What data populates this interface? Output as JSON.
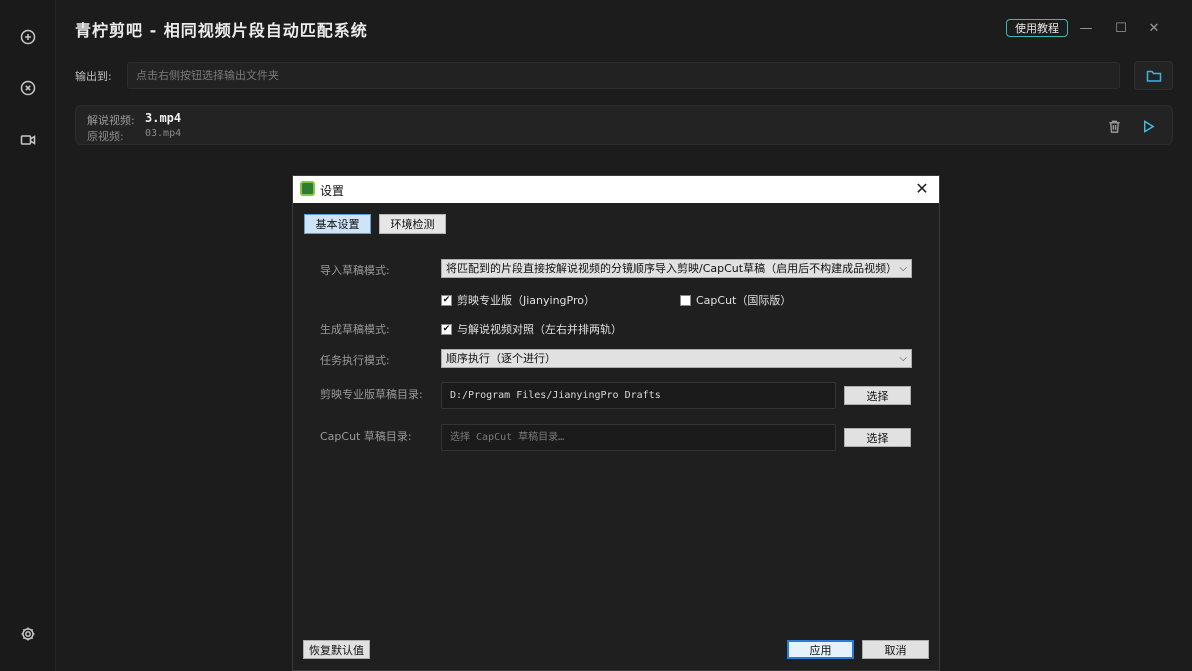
{
  "app": {
    "title": "青柠剪吧 - 相同视频片段自动匹配系统",
    "tutorial_label": "使用教程",
    "minimize": "—",
    "maximize": "☐",
    "close": "✕"
  },
  "output": {
    "label": "输出到:",
    "placeholder": "点击右侧按钮选择输出文件夹"
  },
  "task": {
    "narration_label": "解说视频:",
    "narration_value": "3.mp4",
    "source_label": "原视频:",
    "source_value": "03.mp4"
  },
  "dialog": {
    "title": "设置",
    "close": "✕",
    "tabs": [
      {
        "label": "基本设置",
        "active": true
      },
      {
        "label": "环境检测",
        "active": false
      }
    ],
    "import_mode": {
      "label": "导入草稿模式:",
      "value": "将匹配到的片段直接按解说视频的分镜顺序导入剪映/CapCut草稿（启用后不构建成品视频）"
    },
    "jianying_pro": {
      "label": "剪映专业版（JianyingPro）",
      "checked": true
    },
    "capcut": {
      "label": "CapCut（国际版）",
      "checked": false
    },
    "gen_mode": {
      "label": "生成草稿模式:",
      "option_label": "与解说视频对照（左右并排两轨）",
      "checked": true
    },
    "exec_mode": {
      "label": "任务执行模式:",
      "value": "顺序执行（逐个进行）"
    },
    "jianying_dir": {
      "label": "剪映专业版草稿目录:",
      "value": "D:/Program Files/JianyingPro Drafts",
      "button": "选择"
    },
    "capcut_dir": {
      "label": "CapCut 草稿目录:",
      "placeholder": "选择 CapCut 草稿目录…",
      "button": "选择"
    },
    "reset_label": "恢复默认值",
    "apply_label": "应用",
    "cancel_label": "取消"
  }
}
